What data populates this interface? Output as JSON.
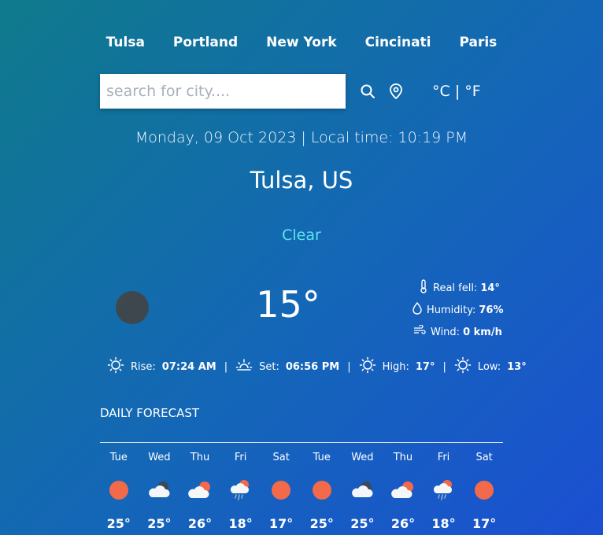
{
  "nav": {
    "cities": [
      "Tulsa",
      "Portland",
      "New York",
      "Cincinati",
      "Paris"
    ]
  },
  "search": {
    "placeholder": "search for city....",
    "value": ""
  },
  "units": {
    "celsius": "°C",
    "separator": "|",
    "fahrenheit": "°F"
  },
  "date_line": "Monday, 09 Oct 2023 | Local time: 10:19 PM",
  "location": "Tulsa, US",
  "condition": "Clear",
  "temperature": "15°",
  "details": {
    "real_feel_label": "Real fell:",
    "real_feel_value": "14°",
    "humidity_label": "Humidity:",
    "humidity_value": "76%",
    "wind_label": "Wind:",
    "wind_value": "0 km/h"
  },
  "sun": {
    "rise_label": "Rise:",
    "rise_value": "07:24 AM",
    "set_label": "Set:",
    "set_value": "06:56 PM",
    "high_label": "High:",
    "high_value": "17°",
    "low_label": "Low:",
    "low_value": "13°",
    "separator": "|"
  },
  "forecast": {
    "title": "DAILY FORECAST",
    "days": [
      {
        "day": "Tue",
        "icon": "sun",
        "temp": "25°"
      },
      {
        "day": "Wed",
        "icon": "cloud-night",
        "temp": "25°"
      },
      {
        "day": "Thu",
        "icon": "cloud-sun",
        "temp": "26°"
      },
      {
        "day": "Fri",
        "icon": "rain-sun",
        "temp": "18°"
      },
      {
        "day": "Sat",
        "icon": "sun",
        "temp": "17°"
      },
      {
        "day": "Tue",
        "icon": "sun",
        "temp": "25°"
      },
      {
        "day": "Wed",
        "icon": "cloud-night",
        "temp": "25°"
      },
      {
        "day": "Thu",
        "icon": "cloud-sun",
        "temp": "26°"
      },
      {
        "day": "Fri",
        "icon": "rain-sun",
        "temp": "18°"
      },
      {
        "day": "Sat",
        "icon": "sun",
        "temp": "17°"
      }
    ]
  },
  "colors": {
    "accent_condition": "#5ee4f0",
    "sun_orange": "#f26a4a"
  }
}
